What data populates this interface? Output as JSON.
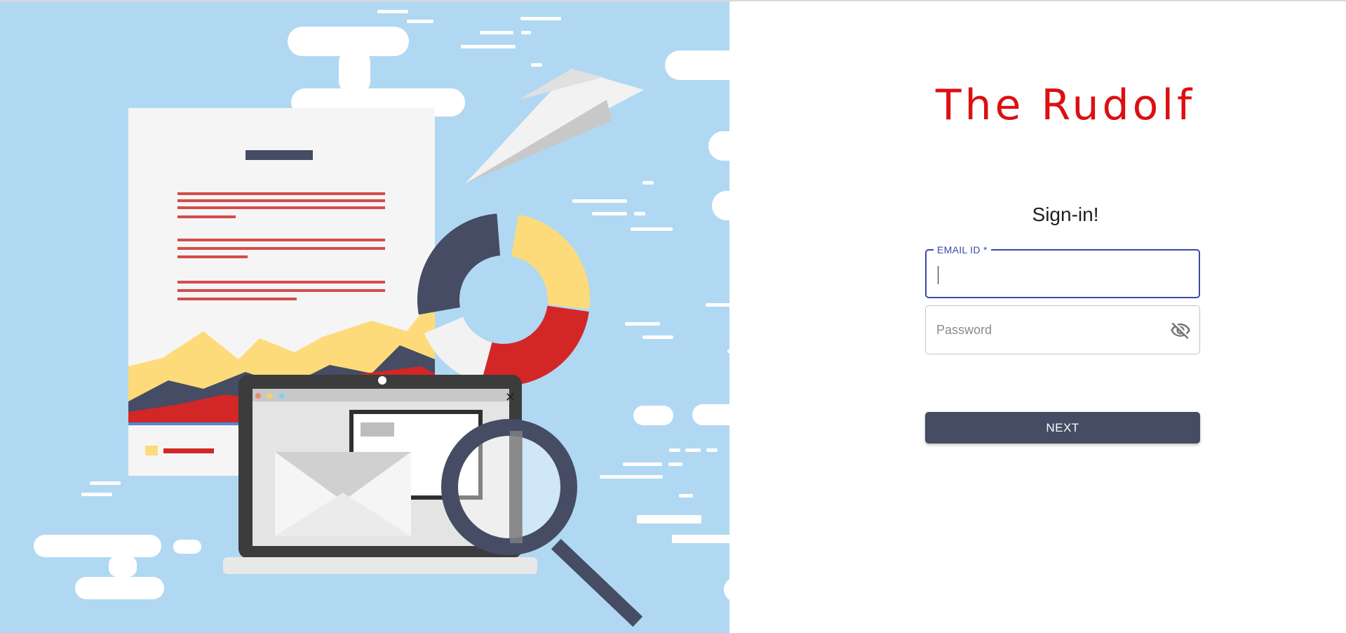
{
  "brand": {
    "title": "The Rudolf",
    "color": "#dd0f11"
  },
  "form": {
    "title": "Sign-in!",
    "email": {
      "label": "EMAIL ID *",
      "value": ""
    },
    "password": {
      "placeholder": "Password",
      "value": "",
      "toggle_icon": "eye-off-icon"
    },
    "next_label": "NEXT"
  },
  "colors": {
    "illustration_background": "#b0d8f2",
    "accent": "#3949ab",
    "button": "#454c64"
  },
  "illustration": {
    "description_icon": "documents-mail-analytics-illustration",
    "icons": [
      "document-icon",
      "paper-plane-icon",
      "donut-chart-icon",
      "laptop-icon",
      "envelope-icon",
      "magnifying-glass-icon",
      "cloud-icon"
    ]
  }
}
